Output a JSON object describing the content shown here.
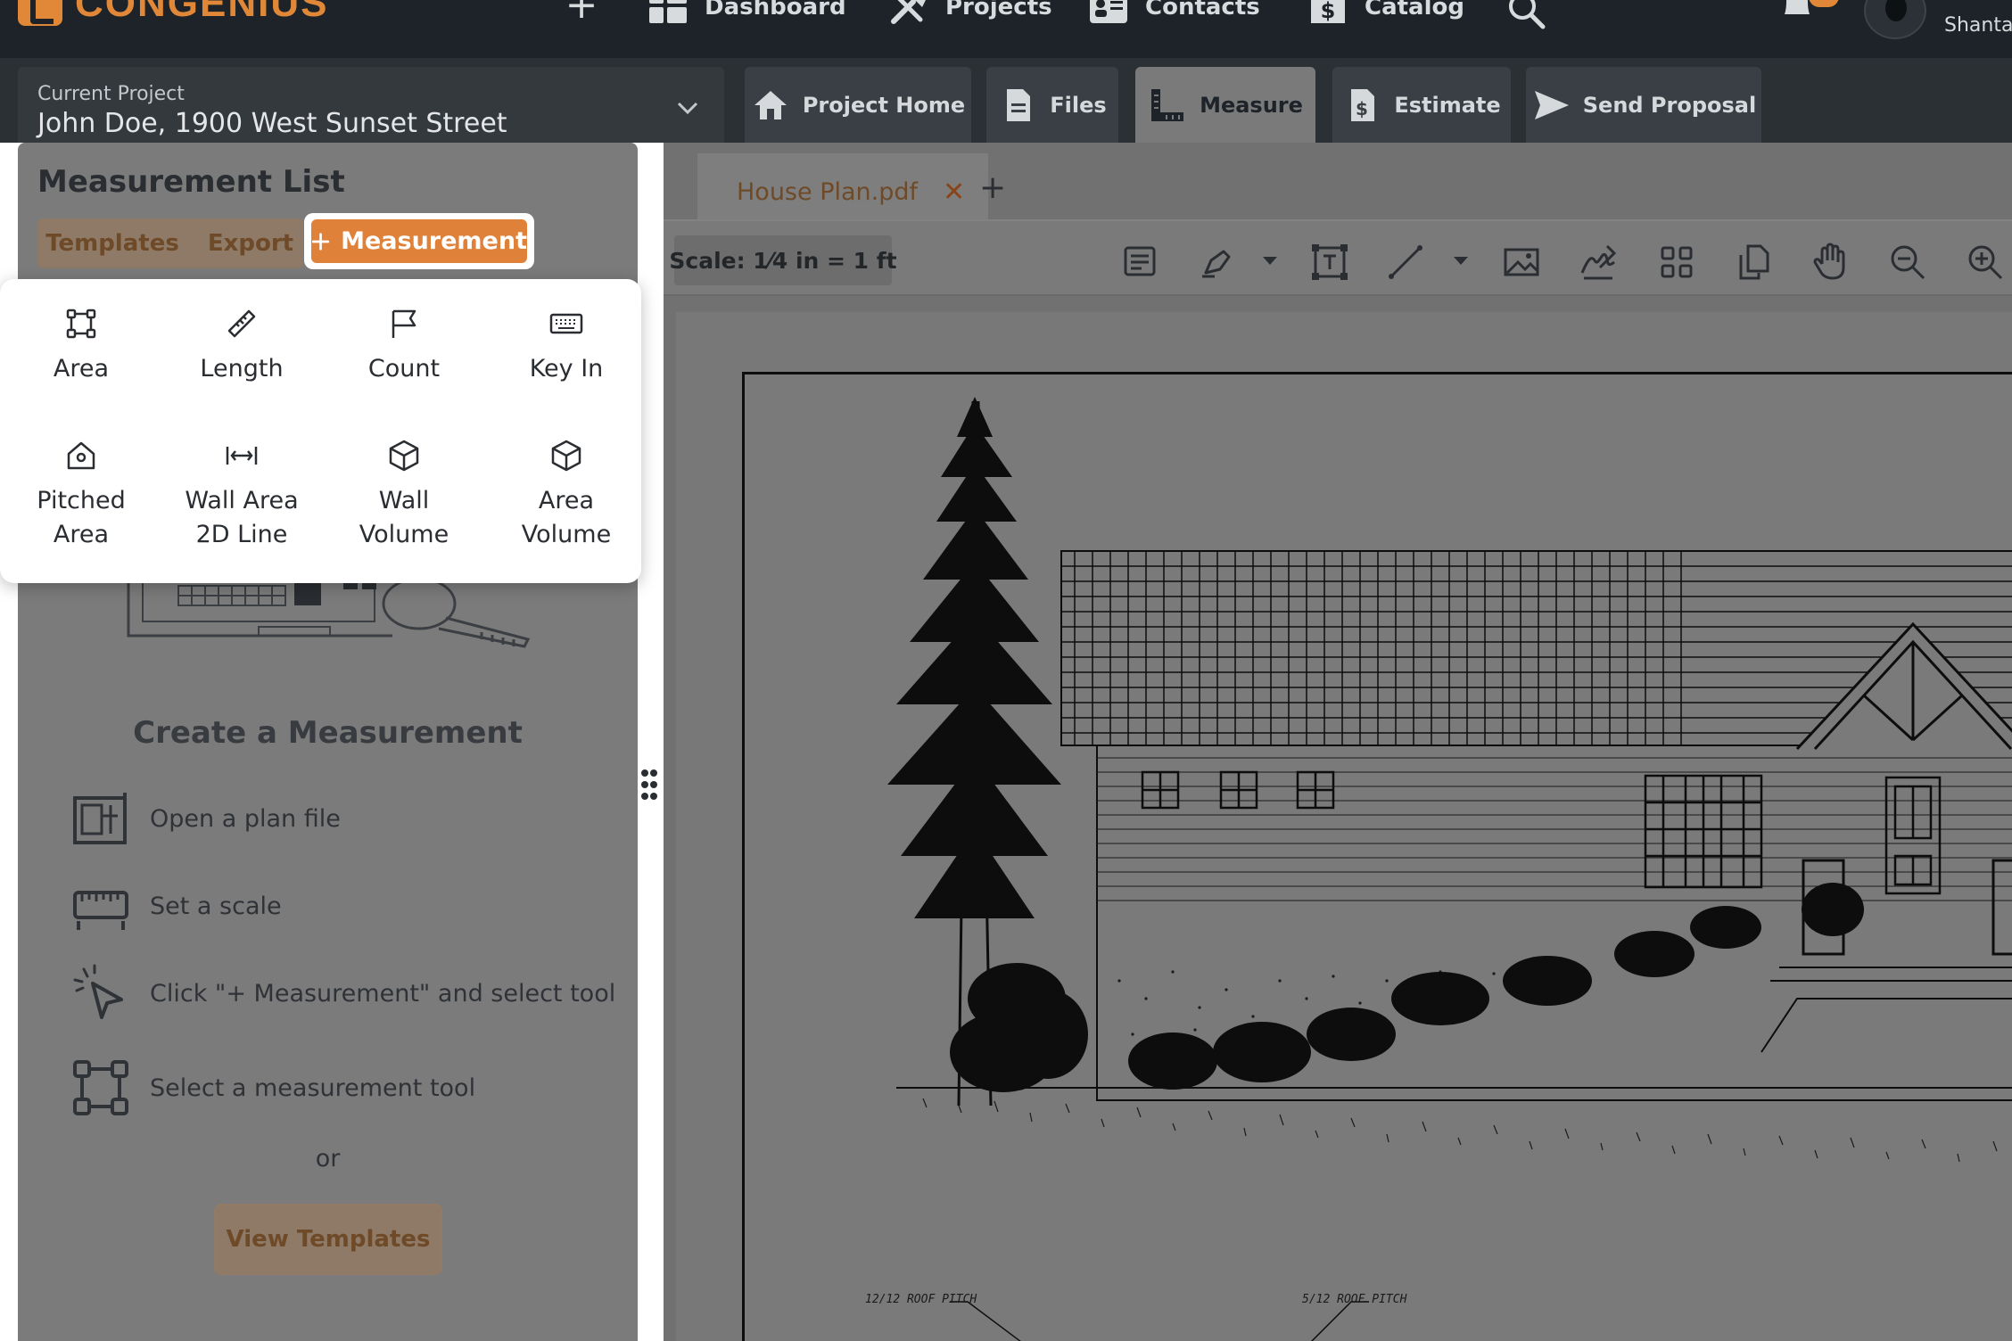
{
  "brand": {
    "name": "CONGENIUS"
  },
  "nav": {
    "dashboard": "Dashboard",
    "projects": "Projects",
    "contacts": "Contacts",
    "catalog": "Catalog",
    "user": "Shanta"
  },
  "project": {
    "label": "Current Project",
    "value": "John Doe, 1900 West Sunset Street"
  },
  "tabs": [
    "Project Home",
    "Files",
    "Measure",
    "Estimate",
    "Send Proposal"
  ],
  "measurement_list": {
    "title": "Measurement List",
    "templates_label": "Templates",
    "export_label": "Export",
    "measurement_btn": "Measurement",
    "create_title": "Create a Measurement",
    "steps": [
      "Open a plan file",
      "Set a scale",
      "Click \"+ Measurement\" and select tool",
      "Select a measurement tool"
    ],
    "or_text": "or",
    "view_templates": "View Templates"
  },
  "menu": [
    {
      "icon": "area-icon",
      "label": "Area"
    },
    {
      "icon": "ruler-icon",
      "label": "Length"
    },
    {
      "icon": "flag-icon",
      "label": "Count"
    },
    {
      "icon": "keyboard-icon",
      "label": "Key In"
    },
    {
      "icon": "house-pitch-icon",
      "label": "Pitched\nArea"
    },
    {
      "icon": "width-arrows-icon",
      "label": "Wall Area\n2D Line"
    },
    {
      "icon": "cube-icon",
      "label": "Wall\nVolume"
    },
    {
      "icon": "cube-icon",
      "label": "Area\nVolume"
    }
  ],
  "file_tab": {
    "name": "House Plan.pdf",
    "close": "✕",
    "add": "+"
  },
  "toolbar": {
    "scale": "Scale: 1⁄4 in = 1 ft"
  },
  "plan": {
    "roof_pitch_left": "12/12 ROOF PITCH",
    "roof_pitch_right": "5/12 ROOF PITCH"
  },
  "colors": {
    "accent": "#e0813a",
    "nav_bg": "#1d2329",
    "overlay": "#7b7b7b"
  }
}
